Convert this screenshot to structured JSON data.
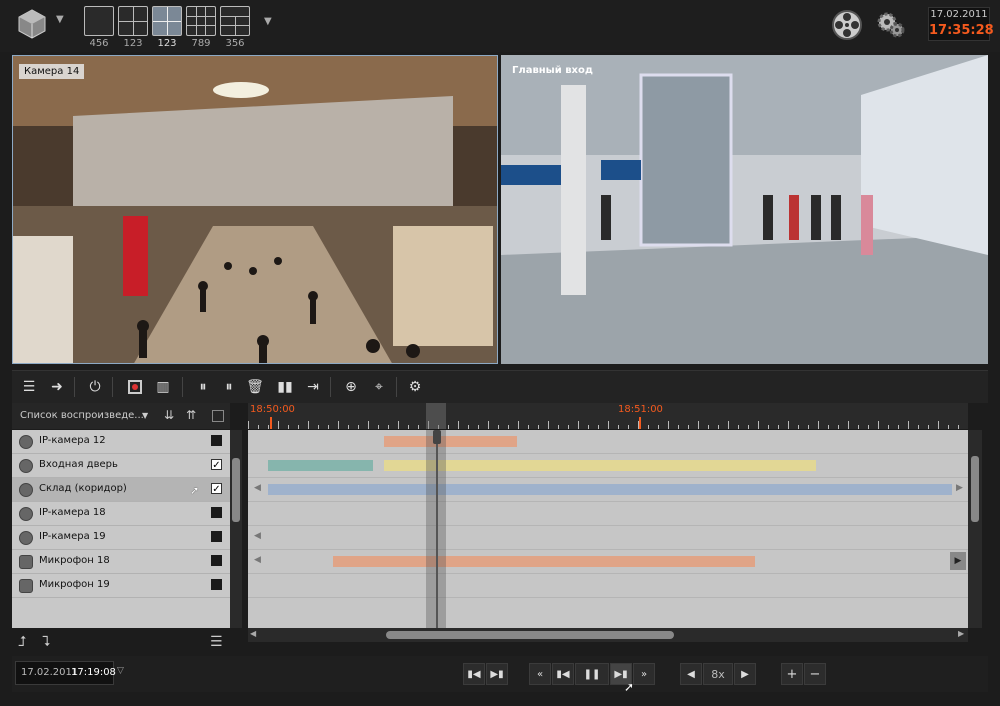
{
  "layouts": [
    {
      "label": "456",
      "type": "1x1",
      "selected": false
    },
    {
      "label": "123",
      "type": "2x2",
      "selected": false
    },
    {
      "label": "123",
      "type": "2x2",
      "selected": true
    },
    {
      "label": "789",
      "type": "3x3",
      "selected": false
    },
    {
      "label": "356",
      "type": "mixed",
      "selected": false
    }
  ],
  "clock": {
    "date": "17.02.2011",
    "time": "17:35:28"
  },
  "cameras": [
    {
      "label": "Камера 14"
    },
    {
      "label": "Главный вход"
    }
  ],
  "list_header": {
    "label": "Список воспроизведе..."
  },
  "ruler": {
    "time_left": "18:50:00",
    "time_right": "18:51:00"
  },
  "devices": [
    {
      "name": "IP-камера 12",
      "checked": false,
      "icon": "camera-icon"
    },
    {
      "name": "Входная дверь",
      "checked": true,
      "icon": "camera-icon"
    },
    {
      "name": "Склад (коридор)",
      "checked": true,
      "icon": "camera-icon",
      "selected": true
    },
    {
      "name": "IP-камера 18",
      "checked": false,
      "icon": "camera-icon"
    },
    {
      "name": "IP-камера 19",
      "checked": false,
      "icon": "camera-icon"
    },
    {
      "name": "Микрофон 18",
      "checked": false,
      "icon": "microphone-icon"
    },
    {
      "name": "Микрофон 19",
      "checked": false,
      "icon": "microphone-icon"
    }
  ],
  "checkmark": "✓",
  "bottom": {
    "date": "17.02.2011",
    "time": "17:19:08",
    "speed": "8x"
  },
  "colors": {
    "accent_time": "#f45a1e",
    "bar_orange": "#e0a487",
    "bar_teal": "#86b5ad",
    "bar_yellow": "#e2d795",
    "bar_blue": "#9fb2cc"
  }
}
